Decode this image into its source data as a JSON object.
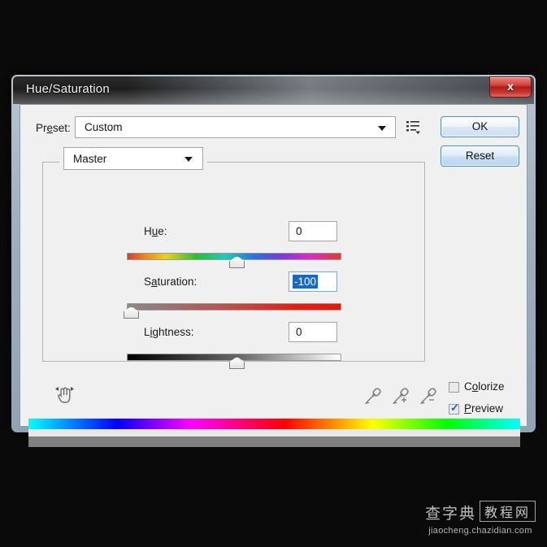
{
  "window": {
    "title": "Hue/Saturation",
    "close_label": "x",
    "close_icon": "close-icon"
  },
  "preset": {
    "label_pre": "Pr",
    "label_accel": "e",
    "label_post": "set:",
    "value": "Custom",
    "arrow_icon": "chevron-down-icon",
    "menu_icon": "preset-options-menu-icon"
  },
  "buttons": {
    "ok": "OK",
    "reset": "Reset"
  },
  "channel": {
    "value": "Master",
    "arrow_icon": "chevron-down-icon"
  },
  "sliders": [
    {
      "label_pre": "H",
      "label_accel": "u",
      "label_post": "e:",
      "name": "hue",
      "value": "0",
      "selected": false,
      "thumb_percent": 50,
      "track": "rainbow"
    },
    {
      "label_pre": "S",
      "label_accel": "a",
      "label_post": "turation:",
      "name": "saturation",
      "value": "-100",
      "selected": true,
      "thumb_percent": 0,
      "track": "gray-to-red"
    },
    {
      "label_pre": "L",
      "label_accel": "i",
      "label_post": "ghtness:",
      "name": "lightness",
      "value": "0",
      "selected": false,
      "thumb_percent": 50,
      "track": "black-to-white"
    }
  ],
  "tools": {
    "hand_icon": "on-image-adjustment-hand-icon",
    "eyedropper_icon": "eyedropper-icon",
    "eyedropper_add_icon": "eyedropper-add-icon",
    "eyedropper_subtract_icon": "eyedropper-subtract-icon"
  },
  "checkboxes": [
    {
      "name": "colorize",
      "label_pre": "C",
      "label_accel": "o",
      "label_post": "lorize",
      "checked": false,
      "mark": ""
    },
    {
      "name": "preview",
      "label_pre": "",
      "label_accel": "P",
      "label_post": "review",
      "checked": true,
      "mark": "✓"
    }
  ],
  "spectrum": {
    "top_bar_colors": [
      "#00ffff",
      "#0000ff",
      "#ff00ff",
      "#ff0000",
      "#ffff00",
      "#00ff00",
      "#00ffff"
    ],
    "bottom_bar_color": "#808080"
  },
  "watermark": {
    "brand": "查字典",
    "badge": "教程网",
    "url": "jiaocheng.chazidian.com"
  }
}
